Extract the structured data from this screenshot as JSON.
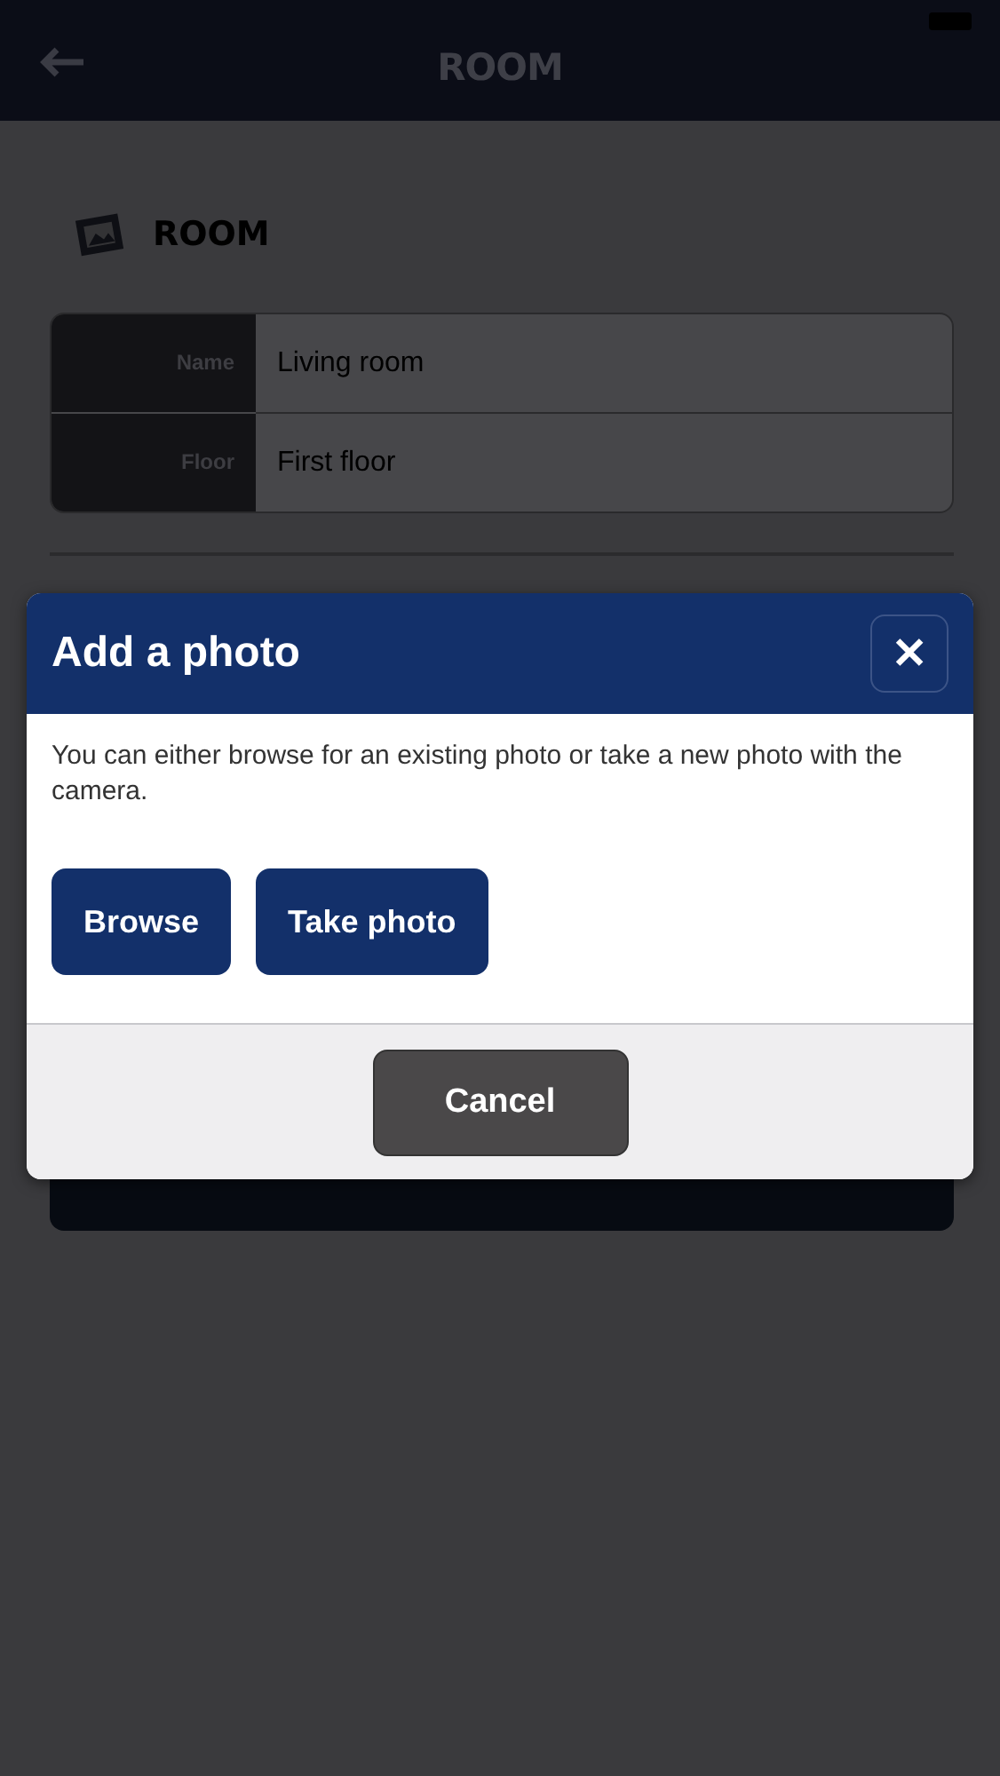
{
  "header": {
    "title": "ROOM"
  },
  "section": {
    "title": "ROOM"
  },
  "fields": [
    {
      "label": "Name",
      "value": "Living room"
    },
    {
      "label": "Floor",
      "value": "First floor"
    }
  ],
  "dialog": {
    "title": "Add a photo",
    "close": "✕",
    "message": "You can either browse for an existing photo or take a new photo with the camera.",
    "actions": [
      "Browse",
      "Take photo"
    ],
    "cancel": "Cancel"
  }
}
